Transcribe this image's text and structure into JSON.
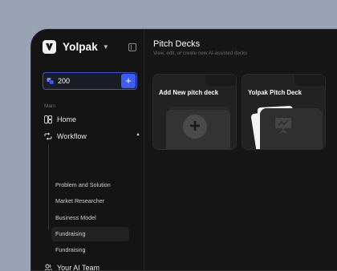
{
  "brand": {
    "name": "Yolpak"
  },
  "sidebar": {
    "credits": "200",
    "add_symbol": "+",
    "section_label": "Main",
    "items": [
      {
        "label": "Home"
      },
      {
        "label": "Workflow"
      }
    ],
    "sub_items": [
      {
        "label": "Problem and Solution"
      },
      {
        "label": "Market Researcher"
      },
      {
        "label": "Business Model"
      },
      {
        "label": "Fundraising"
      },
      {
        "label": "Fundraising"
      }
    ],
    "team_label": "Your AI Team"
  },
  "main": {
    "title": "Pitch Decks",
    "subtitle": "View, edit, or create new AI-assisted decks",
    "cards": [
      {
        "title": "Add New pitch deck",
        "symbol": "+"
      },
      {
        "title": "Yolpak Pitch Deck"
      }
    ]
  },
  "colors": {
    "accent": "#3d5cf0",
    "background": "#161616",
    "outer": "#9aa3b5"
  }
}
